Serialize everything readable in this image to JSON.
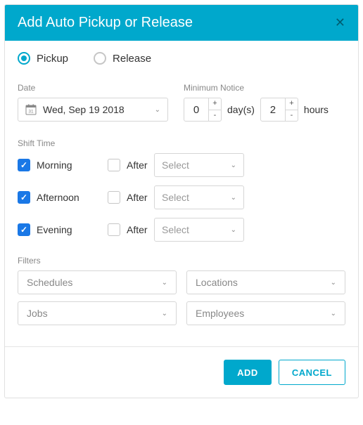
{
  "header": {
    "title": "Add Auto Pickup or Release"
  },
  "mode": {
    "pickup_label": "Pickup",
    "release_label": "Release"
  },
  "date": {
    "label": "Date",
    "value": "Wed, Sep 19 2018"
  },
  "notice": {
    "label": "Minimum Notice",
    "days_value": "0",
    "days_unit": "day(s)",
    "hours_value": "2",
    "hours_unit": "hours"
  },
  "shift": {
    "label": "Shift Time",
    "after_label": "After",
    "select_placeholder": "Select",
    "times": [
      "Morning",
      "Afternoon",
      "Evening"
    ]
  },
  "filters": {
    "label": "Filters",
    "schedules": "Schedules",
    "locations": "Locations",
    "jobs": "Jobs",
    "employees": "Employees"
  },
  "buttons": {
    "add": "ADD",
    "cancel": "CANCEL"
  }
}
